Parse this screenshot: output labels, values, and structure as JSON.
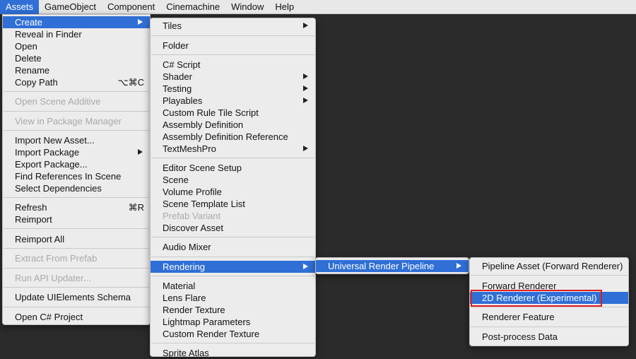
{
  "menubar": {
    "items": [
      "Assets",
      "GameObject",
      "Component",
      "Cinemachine",
      "Window",
      "Help"
    ]
  },
  "assets_menu": {
    "create": "Create",
    "reveal_in_finder": "Reveal in Finder",
    "open": "Open",
    "delete": "Delete",
    "rename": "Rename",
    "copy_path": "Copy Path",
    "copy_path_shortcut": "⌥⌘C",
    "open_scene_additive": "Open Scene Additive",
    "view_in_package_manager": "View in Package Manager",
    "import_new_asset": "Import New Asset...",
    "import_package": "Import Package",
    "export_package": "Export Package...",
    "find_references": "Find References In Scene",
    "select_dependencies": "Select Dependencies",
    "refresh": "Refresh",
    "refresh_shortcut": "⌘R",
    "reimport": "Reimport",
    "reimport_all": "Reimport All",
    "extract_from_prefab": "Extract From Prefab",
    "run_api_updater": "Run API Updater...",
    "update_uielements_schema": "Update UIElements Schema",
    "open_csharp_project": "Open C# Project"
  },
  "create_menu": {
    "tiles": "Tiles",
    "folder": "Folder",
    "csharp_script": "C# Script",
    "shader": "Shader",
    "testing": "Testing",
    "playables": "Playables",
    "custom_rule_tile_script": "Custom Rule Tile Script",
    "assembly_definition": "Assembly Definition",
    "assembly_definition_reference": "Assembly Definition Reference",
    "textmeshpro": "TextMeshPro",
    "editor_scene_setup": "Editor Scene Setup",
    "scene": "Scene",
    "volume_profile": "Volume Profile",
    "scene_template_list": "Scene Template List",
    "prefab_variant": "Prefab Variant",
    "discover_asset": "Discover Asset",
    "audio_mixer": "Audio Mixer",
    "rendering": "Rendering",
    "material": "Material",
    "lens_flare": "Lens Flare",
    "render_texture": "Render Texture",
    "lightmap_parameters": "Lightmap Parameters",
    "custom_render_texture": "Custom Render Texture",
    "sprite_atlas_partial": "Sprite Atlas"
  },
  "rendering_menu": {
    "universal_render_pipeline": "Universal Render Pipeline"
  },
  "urp_menu": {
    "pipeline_asset": "Pipeline Asset (Forward Renderer)",
    "forward_renderer": "Forward Renderer",
    "renderer_2d": "2D Renderer (Experimental)",
    "renderer_feature": "Renderer Feature",
    "post_process_data": "Post-process Data"
  },
  "colors": {
    "highlight": "#2f6fd6",
    "annotation": "#e31b1b"
  }
}
